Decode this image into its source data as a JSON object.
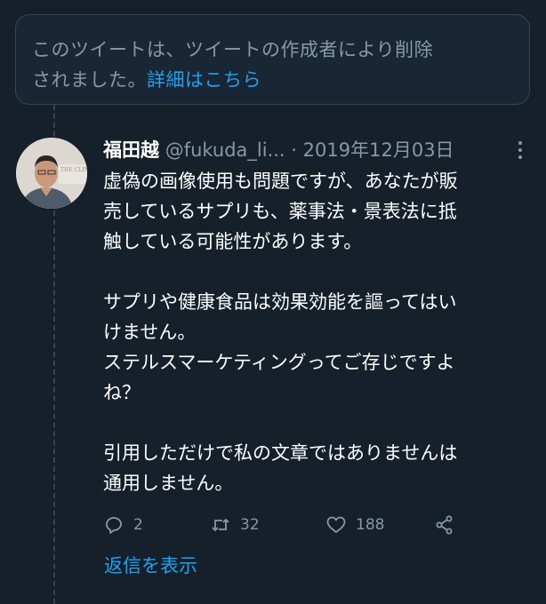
{
  "deleted_notice": {
    "line1": "このツイートは、ツイートの作成者により削除",
    "line2": "されました。",
    "link": "詳細はこちら"
  },
  "tweet": {
    "author_name": "福田越",
    "author_handle": "@fukuda_li...",
    "separator": "·",
    "date": "2019年12月03日",
    "body": [
      "虚偽の画像使用も問題ですが、あなたが販\n売しているサプリも、薬事法・景表法に抵\n触している可能性があります。",
      "",
      "サプリや健康食品は効果効能を謳ってはい\nけません。\nステルスマーケティングってご存じですよ\nね？",
      "",
      "引用しただけで私の文章ではありませんは\n通用しません。"
    ],
    "replies": "2",
    "retweets": "32",
    "likes": "188"
  },
  "show_replies_label": "返信を表示",
  "colors": {
    "background": "#15202b",
    "secondary_text": "#8899a6",
    "accent": "#1da1f2",
    "border": "#38444d"
  },
  "icons": {
    "reply": "reply-icon",
    "retweet": "retweet-icon",
    "like": "heart-icon",
    "share": "share-icon",
    "more": "more-vertical-icon"
  }
}
